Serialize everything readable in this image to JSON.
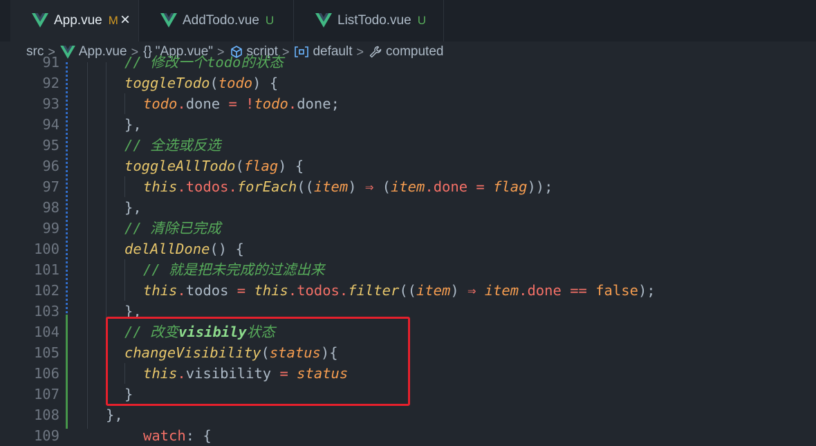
{
  "tabs": [
    {
      "label": "App.vue",
      "status": "M",
      "close": "×"
    },
    {
      "label": "AddTodo.vue",
      "status": "U"
    },
    {
      "label": "ListTodo.vue",
      "status": "U"
    }
  ],
  "breadcrumb": {
    "src": "src",
    "file": "App.vue",
    "braces": "{}",
    "object": "\"App.vue\"",
    "script": "script",
    "default": "default",
    "computed": "computed",
    "sep": ">"
  },
  "editor": {
    "line_numbers": [
      "91",
      "92",
      "93",
      "94",
      "95",
      "96",
      "97",
      "98",
      "99",
      "100",
      "101",
      "102",
      "103",
      "104",
      "105",
      "106",
      "107",
      "108",
      "109"
    ],
    "comments": {
      "c91": "// 修改一个todo的状态",
      "c95": "// 全选或反选",
      "c99": "// 清除已完成",
      "c101": "// 就是把未完成的过滤出来",
      "c104_prefix": "// 改变",
      "c104_kw": "visibily",
      "c104_suffix": "状态"
    },
    "tokens": {
      "toggleTodo": "toggleTodo",
      "todo": "todo",
      "done": "done",
      "bang": "!",
      "toggleAllTodo": "toggleAllTodo",
      "flag": "flag",
      "this": "this",
      "todos": "todos",
      "forEach": "forEach",
      "item": "item",
      "arrow": "⇒",
      "delAllDone": "delAllDone",
      "filter": "filter",
      "eqeq": "==",
      "false": "false",
      "changeVisibility": "changeVisibility",
      "status": "status",
      "visibility": "visibility",
      "eq": "=",
      "open_brace": "{",
      "close_brace": "}",
      "close_brace_comma": "},",
      "watch_kw": "watch"
    }
  },
  "colors": {
    "background": "#22272e",
    "tab_bar": "#1c2128",
    "vue_green": "#41b883",
    "highlight_border": "#e5202c",
    "comment": "#57ab5a",
    "function": "#dcbdfb",
    "property": "#f47067",
    "this_keyword": "#e7c66b",
    "parameter": "#f69d50"
  },
  "icons": [
    "vue-logo-icon",
    "close-icon",
    "cube-icon",
    "bracket-module-icon",
    "wrench-icon",
    "chevron-right-icon"
  ]
}
